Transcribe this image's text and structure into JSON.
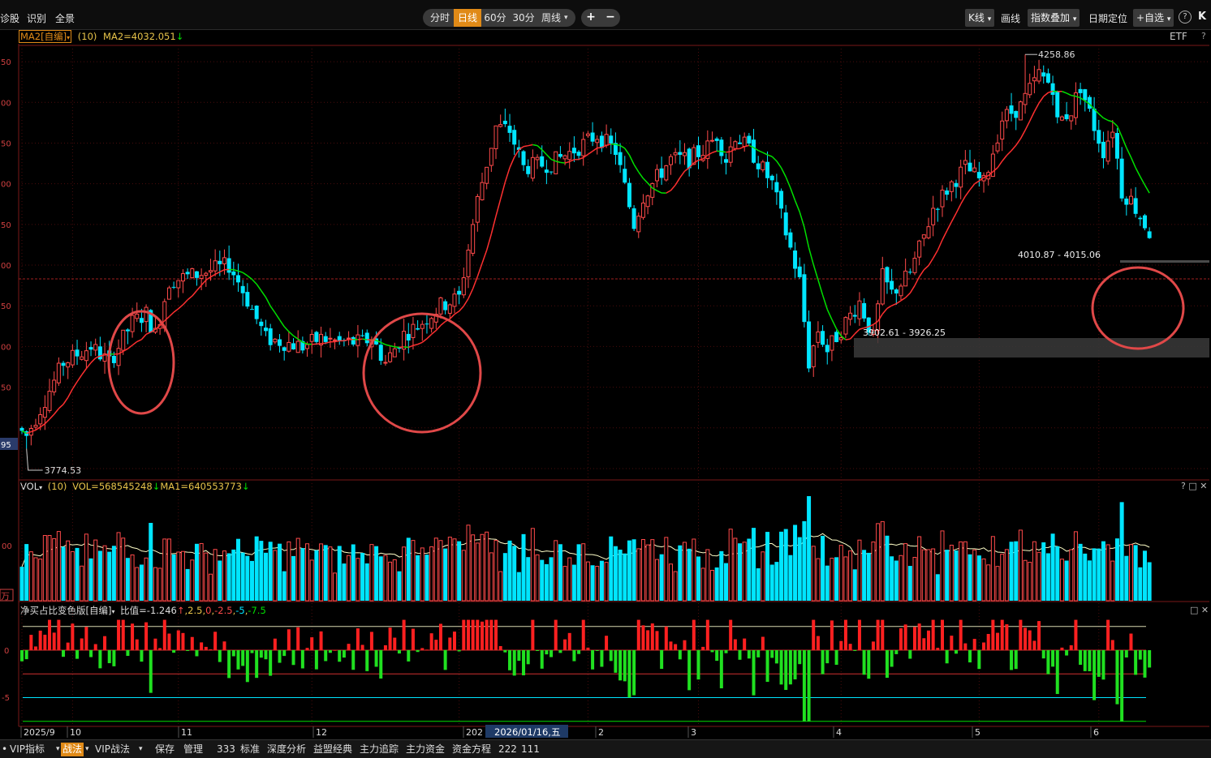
{
  "toolbar": {
    "left_items": [
      "诊股",
      "识别",
      "全景"
    ],
    "periods": [
      "分时",
      "日线",
      "60分",
      "30分",
      "周线"
    ],
    "active_period": "日线",
    "zoom_in": "+",
    "zoom_out": "−",
    "kline_label": "K线",
    "draw_label": "画线",
    "overlay_label": "指数叠加",
    "date_locate": "日期定位",
    "add_watch": "+自选",
    "help": "?",
    "collapse": "K"
  },
  "main_header": {
    "ma_select": "MA2[自编]",
    "param": "(10)",
    "ma_value": "MA2=4032.051",
    "right_label": "ETF",
    "right_q": "?"
  },
  "vol_header": {
    "name": "VOL",
    "param": "(10)",
    "vol_value": "VOL=568545248",
    "ma_value": "MA1=640553773",
    "icons": "? □ ✕"
  },
  "net_header": {
    "name": "净买占比变色版[自编]",
    "value": "比值=-1.246",
    "levels": [
      "2.5",
      "0",
      "-2.5",
      "-5",
      "-7.5"
    ],
    "icons": "□ ✕"
  },
  "left_axis": {
    "price_edge_labels": [
      "50",
      "00",
      "50",
      "00",
      "50",
      "00",
      "50",
      "00",
      "50",
      "95"
    ],
    "vol_edge_label": "00",
    "vol_unit": "万",
    "net_edge_labels": [
      "0",
      "-5"
    ]
  },
  "chart_data": {
    "type": "candlestick",
    "price_range": [
      3740,
      4270
    ],
    "high_label": "4258.86",
    "low_label": "3774.53",
    "zone_labels": [
      "4010.87 - 4015.06",
      "3902.61 - 3926.25"
    ],
    "x_labels": [
      "2025/9",
      "10",
      "11",
      "12",
      "202",
      "2026/01/16,五",
      "2",
      "3",
      "4",
      "5",
      "6"
    ],
    "net_levels": [
      2.5,
      0,
      -2.5,
      -5,
      -7.5
    ],
    "ohlc": [],
    "ma": [],
    "volume": [],
    "net": []
  },
  "colors": {
    "up": "#ff4a4a",
    "down": "#00e5ff",
    "ma_up": "#ff3030",
    "ma_down": "#00e000",
    "vol_ma": "#ffffc8",
    "accent": "#e08a17",
    "annotation": "#e04848"
  },
  "bottom_bar": [
    "VIP指标",
    "战法",
    "VIP战法",
    "保存",
    "管理",
    "333",
    "标准",
    "深度分析",
    "益盟经典",
    "主力追踪",
    "主力资金",
    "资金方程",
    "222",
    "111"
  ],
  "bottom_active": "战法"
}
